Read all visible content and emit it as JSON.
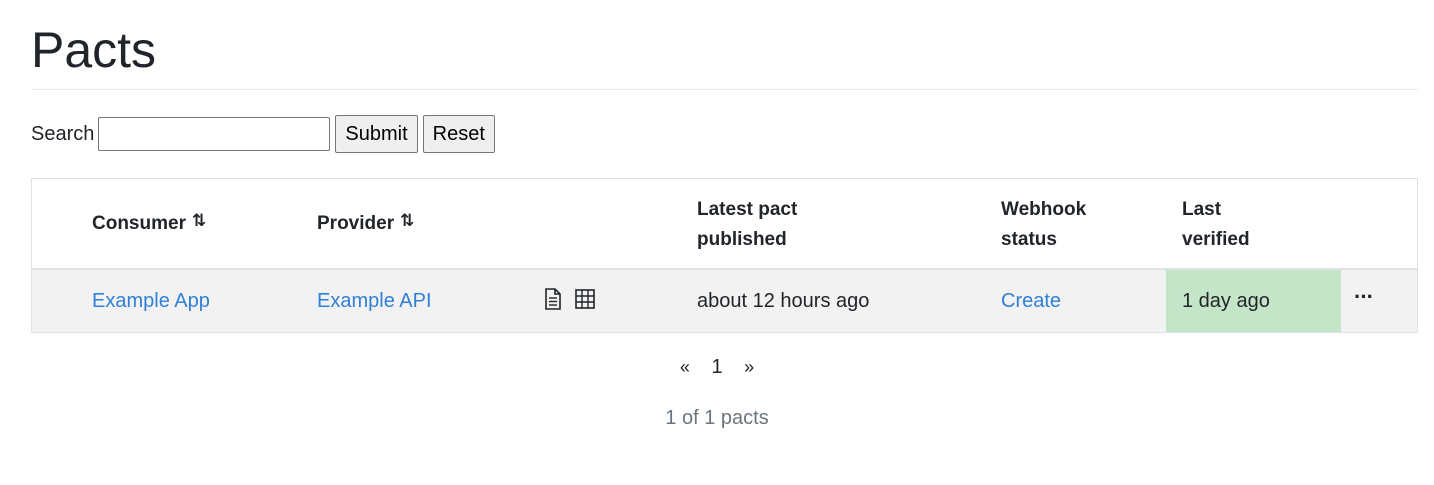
{
  "page": {
    "title": "Pacts"
  },
  "search": {
    "label": "Search",
    "value": "",
    "placeholder": "",
    "submit_label": "Submit",
    "reset_label": "Reset"
  },
  "table": {
    "headers": {
      "consumer": "Consumer",
      "provider": "Provider",
      "latest_pact_line1": "Latest pact",
      "latest_pact_line2": "published",
      "webhook_line1": "Webhook",
      "webhook_line2": "status",
      "last_verified_line1": "Last",
      "last_verified_line2": "verified"
    },
    "sort_glyph": "⇅",
    "rows": [
      {
        "consumer": "Example App",
        "provider": "Example API",
        "doc_icon": "document-icon",
        "matrix_icon": "table-grid-icon",
        "latest_pact_published": "about 12 hours ago",
        "webhook_status": "Create",
        "last_verified": "1 day ago",
        "menu_glyph": "···"
      }
    ]
  },
  "pagination": {
    "prev": "«",
    "current": "1",
    "next": "»",
    "summary": "1 of 1 pacts"
  },
  "colors": {
    "link": "#2f80d6",
    "verified_success_bg": "#c5e5c9",
    "row_bg": "#f2f2f2"
  }
}
